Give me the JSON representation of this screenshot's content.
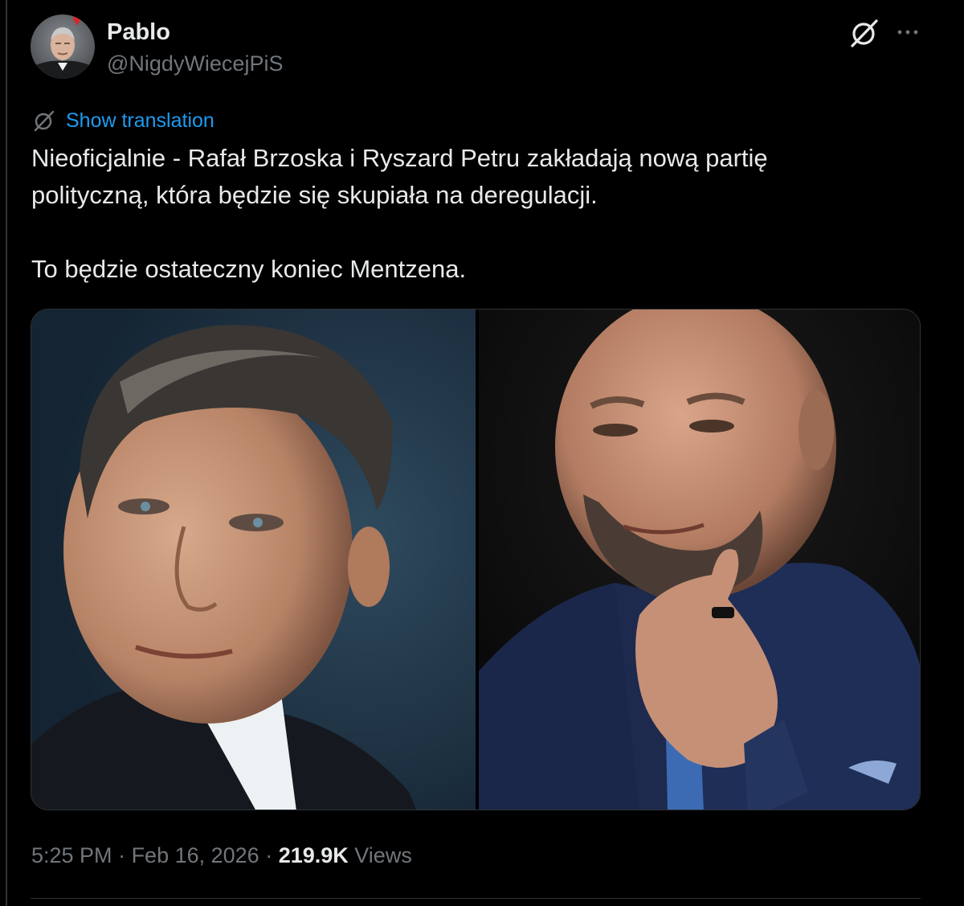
{
  "author": {
    "name": "Pablo",
    "handle": "@NigdyWiecejPiS"
  },
  "header_icons": [
    "grok-icon",
    "more-icon"
  ],
  "translation": {
    "label": "Show translation",
    "icon": "translate-icon"
  },
  "tweet": {
    "line1": "Nieoficjalnie - Rafał Brzoska i Ryszard Petru zakładają nową partię",
    "line2": "polityczną, która będzie się skupiała na deregulacji.",
    "line3": "To będzie ostateczny koniec Mentzena."
  },
  "media": {
    "count": 2
  },
  "meta": {
    "time": "5:25 PM",
    "sep1": " · ",
    "date": "Feb 16, 2026",
    "sep2": " · ",
    "views_count": "219.9K",
    "views_label": " Views"
  },
  "colors": {
    "background": "#000000",
    "text": "#e7e9ea",
    "secondary": "#71767b",
    "link": "#1d9bf0",
    "border": "#2f3336"
  }
}
